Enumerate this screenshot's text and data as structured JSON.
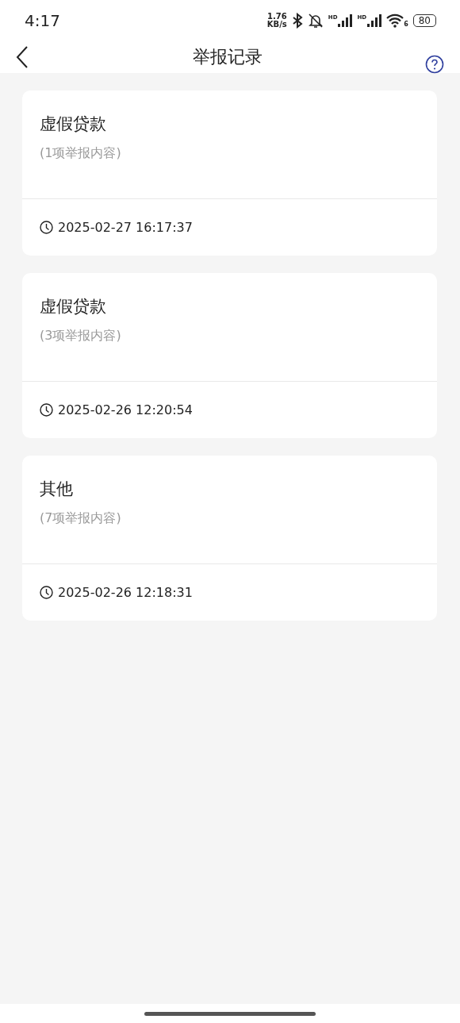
{
  "status_bar": {
    "time": "4:17",
    "net_speed": "1.76",
    "net_unit": "KB/s",
    "signal_labels": [
      "HD",
      "HD"
    ],
    "wifi_label": "6",
    "battery": "80"
  },
  "header": {
    "title": "举报记录"
  },
  "records": [
    {
      "title": "虚假贷款",
      "count": "(1项举报内容)",
      "time": "2025-02-27 16:17:37"
    },
    {
      "title": "虚假贷款",
      "count": "(3项举报内容)",
      "time": "2025-02-26 12:20:54"
    },
    {
      "title": "其他",
      "count": "(7项举报内容)",
      "time": "2025-02-26 12:18:31"
    }
  ]
}
